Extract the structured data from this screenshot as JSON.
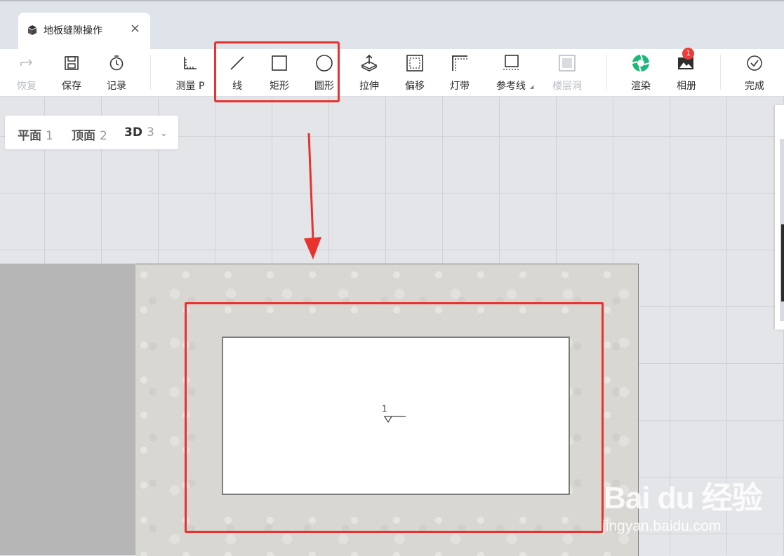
{
  "tab": {
    "title": "地板缝隙操作",
    "close": "×"
  },
  "toolbar": {
    "redo": "恢复",
    "save": "保存",
    "history": "记录",
    "measure": "测量 P",
    "line": "线",
    "rect": "矩形",
    "circle": "圆形",
    "extrude": "拉伸",
    "offset": "偏移",
    "lightstrip": "灯带",
    "guide": "参考线",
    "floorhole": "楼层洞",
    "render": "渲染",
    "album": "相册",
    "album_badge": "1",
    "done": "完成"
  },
  "views": [
    {
      "name": "平面",
      "key": "1"
    },
    {
      "name": "顶面",
      "key": "2"
    },
    {
      "name": "3D",
      "key": "3"
    }
  ],
  "canvas": {
    "marker": "1"
  },
  "watermark": {
    "logo": "Bai du 经验",
    "url": "jingyan.baidu.com"
  },
  "colors": {
    "highlight": "#e8322e",
    "render_icon": "#1fb67a",
    "badge": "#ef3a3a"
  }
}
